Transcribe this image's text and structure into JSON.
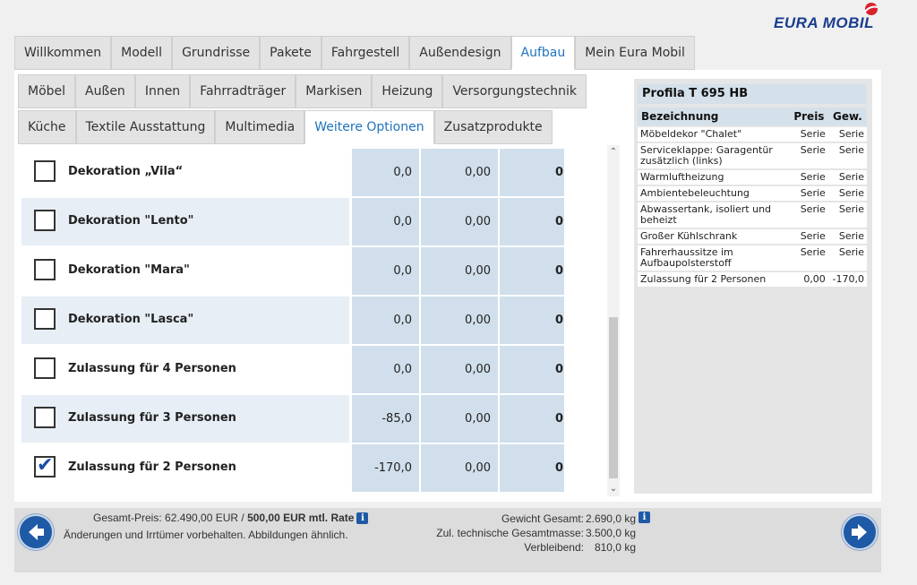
{
  "brand": {
    "logo_text": "EURA MOBIL",
    "accent_color": "#1e73be",
    "brand_color": "#1a3c8e",
    "logo_mark_color": "#d9232d"
  },
  "tabs_main": [
    {
      "label": "Willkommen"
    },
    {
      "label": "Modell"
    },
    {
      "label": "Grundrisse"
    },
    {
      "label": "Pakete"
    },
    {
      "label": "Fahrgestell"
    },
    {
      "label": "Außendesign"
    },
    {
      "label": "Aufbau",
      "active": true
    },
    {
      "label": "Mein Eura Mobil"
    }
  ],
  "tabs_sub1": [
    {
      "label": "Möbel"
    },
    {
      "label": "Außen"
    },
    {
      "label": "Innen"
    },
    {
      "label": "Fahrradträger"
    },
    {
      "label": "Markisen"
    },
    {
      "label": "Heizung"
    },
    {
      "label": "Versorgungstechnik"
    }
  ],
  "tabs_sub2": [
    {
      "label": "Küche"
    },
    {
      "label": "Textile Ausstattung"
    },
    {
      "label": "Multimedia"
    },
    {
      "label": "Weitere Optionen",
      "active": true
    },
    {
      "label": "Zusatzprodukte"
    }
  ],
  "options": [
    {
      "name": "Dekoration „Vila“",
      "price": "0,0",
      "weight": "0,00",
      "extra": "0",
      "checked": false
    },
    {
      "name": "Dekoration \"Lento\"",
      "price": "0,0",
      "weight": "0,00",
      "extra": "0",
      "checked": false
    },
    {
      "name": "Dekoration \"Mara\"",
      "price": "0,0",
      "weight": "0,00",
      "extra": "0",
      "checked": false
    },
    {
      "name": "Dekoration \"Lasca\"",
      "price": "0,0",
      "weight": "0,00",
      "extra": "0",
      "checked": false
    },
    {
      "name": "Zulassung für 4 Personen",
      "price": "0,0",
      "weight": "0,00",
      "extra": "0",
      "checked": false
    },
    {
      "name": "Zulassung für 3 Personen",
      "price": "-85,0",
      "weight": "0,00",
      "extra": "0",
      "checked": false
    },
    {
      "name": "Zulassung für 2 Personen",
      "price": "-170,0",
      "weight": "0,00",
      "extra": "0",
      "checked": true
    }
  ],
  "summary": {
    "title": "Profila T 695 HB",
    "headers": {
      "name": "Bezeichnung",
      "price": "Preis",
      "weight": "Gew."
    },
    "rows": [
      {
        "name": "Möbeldekor \"Chalet\"",
        "price": "Serie",
        "weight": "Serie"
      },
      {
        "name": "Serviceklappe: Garagentür zusätzlich (links)",
        "price": "Serie",
        "weight": "Serie"
      },
      {
        "name": "Warmluftheizung",
        "price": "Serie",
        "weight": "Serie"
      },
      {
        "name": "Ambientebeleuchtung",
        "price": "Serie",
        "weight": "Serie"
      },
      {
        "name": "Abwassertank, isoliert und beheizt",
        "price": "Serie",
        "weight": "Serie"
      },
      {
        "name": "Großer Kühlschrank",
        "price": "Serie",
        "weight": "Serie"
      },
      {
        "name": "Fahrerhaussitze im Aufbaupolsterstoff",
        "price": "Serie",
        "weight": "Serie"
      },
      {
        "name": "Zulassung für 2 Personen",
        "price": "0,00",
        "weight": "-170,0"
      }
    ]
  },
  "footer": {
    "total_price_label": "Gesamt-Preis: 62.490,00 EUR / ",
    "monthly_rate": "500,00 EUR mtl. Rate",
    "disclaimer": "Änderungen und Irrtümer vorbehalten. Abbildungen ähnlich.",
    "info_glyph": "i",
    "weight_total_label": "Gewicht Gesamt:",
    "weight_total_value": "2.690,0 kg",
    "tech_mass_label": "Zul. technische Gesamtmasse:",
    "tech_mass_value": "3.500,0 kg",
    "remaining_label": "Verbleibend:",
    "remaining_value": "810,0 kg"
  }
}
